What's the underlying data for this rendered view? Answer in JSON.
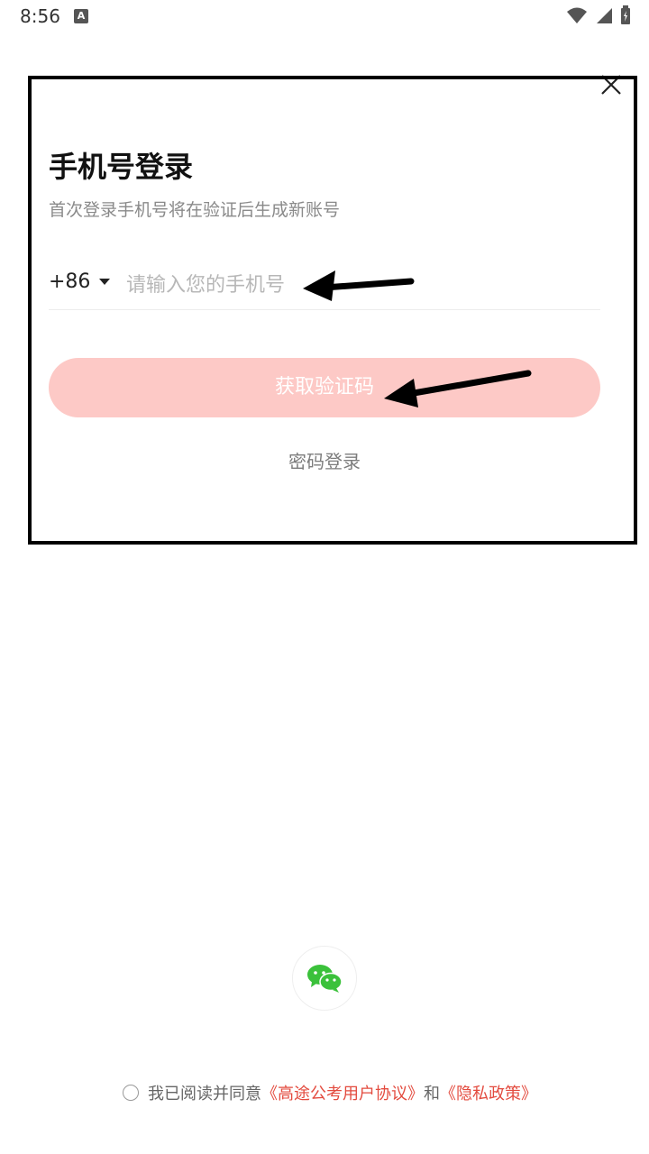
{
  "status_bar": {
    "time": "8:56",
    "notif_letter": "A"
  },
  "login": {
    "title": "手机号登录",
    "subtitle": "首次登录手机号将在验证后生成新账号",
    "country_code": "+86",
    "phone_placeholder": "请输入您的手机号",
    "get_code_label": "获取验证码",
    "password_login_label": "密码登录"
  },
  "agreement": {
    "prefix": "我已阅读并同意",
    "user_agreement": "《高途公考用户协议》",
    "and": "和",
    "privacy_policy": "《隐私政策》"
  },
  "icons": {
    "close": "close-icon",
    "wechat": "wechat-icon",
    "wifi": "wifi-icon",
    "signal": "signal-icon",
    "battery": "battery-icon"
  },
  "colors": {
    "primary_button_disabled": "#fdc9c6",
    "link": "#e34b3f",
    "wechat": "#3bc13b"
  }
}
